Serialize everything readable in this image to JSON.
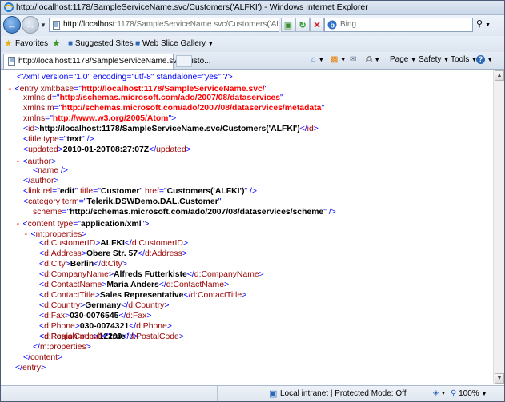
{
  "window": {
    "title": "http://localhost:1178/SampleServiceName.svc/Customers('ALFKI') - Windows Internet Explorer"
  },
  "address_bar": {
    "url_host": "http://localhost",
    "url_rest": ":1178/SampleServiceName.svc/Customers('ALFKI')"
  },
  "search": {
    "placeholder": "Bing"
  },
  "favorites_bar": {
    "favorites_label": "Favorites",
    "items": [
      "Suggested Sites",
      "Web Slice Gallery"
    ]
  },
  "tab": {
    "label": "http://localhost:1178/SampleServiceName.svc/Custo..."
  },
  "command_bar": {
    "page": "Page",
    "safety": "Safety",
    "tools": "Tools"
  },
  "xml": {
    "declaration": "<?xml version=\"1.0\" encoding=\"utf-8\" standalone=\"yes\" ?>",
    "entry_xml_base": "http://localhost:1178/SampleServiceName.svc/",
    "xmlns_d": "http://schemas.microsoft.com/ado/2007/08/dataservices",
    "xmlns_m": "http://schemas.microsoft.com/ado/2007/08/dataservices/metadata",
    "xmlns": "http://www.w3.org/2005/Atom",
    "id": "http://localhost:1178/SampleServiceName.svc/Customers('ALFKI')",
    "title_type": "text",
    "updated": "2010-01-20T08:27:07Z",
    "link_rel": "edit",
    "link_title": "Customer",
    "link_href": "Customers('ALFKI')",
    "category_term": "Telerik.DSWDemo.DAL.Customer",
    "category_scheme": "http://schemas.microsoft.com/ado/2007/08/dataservices/scheme",
    "content_type": "application/xml",
    "properties": [
      {
        "name": "CustomerID",
        "value": "ALFKI"
      },
      {
        "name": "Address",
        "value": "Obere Str. 57"
      },
      {
        "name": "City",
        "value": "Berlin"
      },
      {
        "name": "CompanyName",
        "value": "Alfreds Futterkiste"
      },
      {
        "name": "ContactName",
        "value": "Maria Anders"
      },
      {
        "name": "ContactTitle",
        "value": "Sales Representative"
      },
      {
        "name": "Country",
        "value": "Germany"
      },
      {
        "name": "Fax",
        "value": "030-0076545"
      },
      {
        "name": "Phone",
        "value": "030-0074321"
      },
      {
        "name": "PostalCode",
        "value": "12209"
      }
    ],
    "region_null": "true"
  },
  "status_bar": {
    "zone": "Local intranet | Protected Mode: Off",
    "zoom": "100%"
  }
}
